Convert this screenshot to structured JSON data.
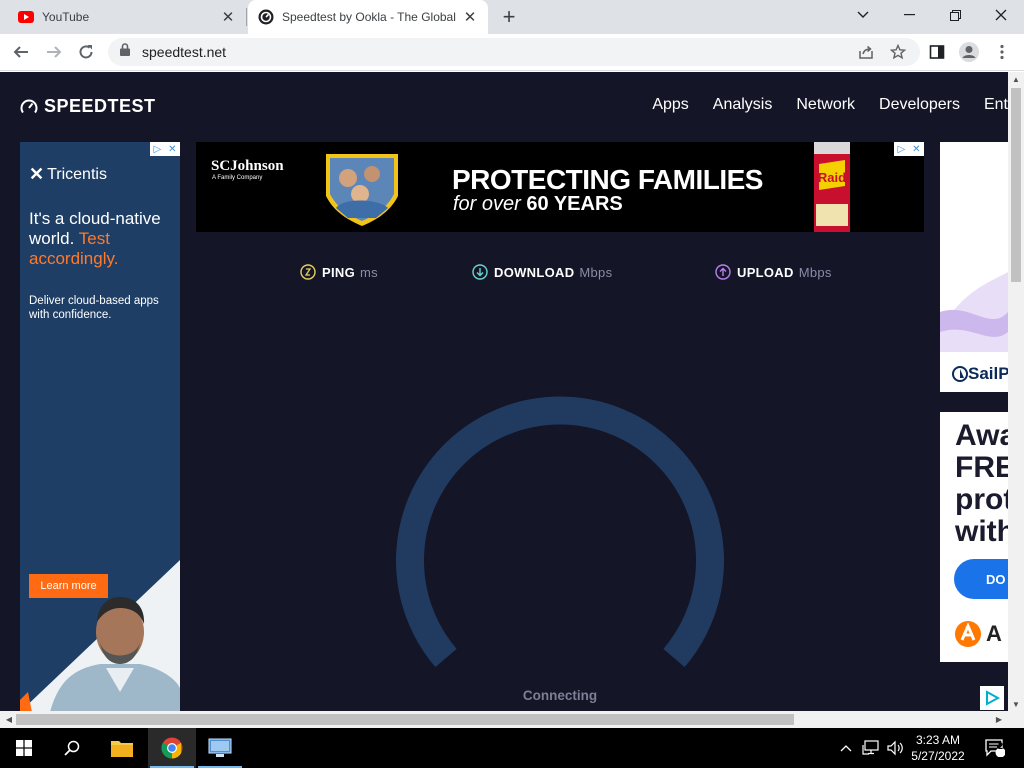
{
  "browser": {
    "tabs": [
      {
        "title": "YouTube",
        "icon": "youtube-icon",
        "active": false
      },
      {
        "title": "Speedtest by Ookla - The Global",
        "icon": "speedtest-icon",
        "active": true
      }
    ],
    "url": "speedtest.net"
  },
  "site": {
    "logo_text": "SPEEDTEST",
    "nav": [
      "Apps",
      "Analysis",
      "Network",
      "Developers",
      "Ent"
    ]
  },
  "ads": {
    "left": {
      "brand": "Tricentis",
      "headline_1": "It's a cloud-native world.",
      "headline_2": "Test accordingly.",
      "sub": "Deliver cloud-based apps with confidence.",
      "cta": "Learn more"
    },
    "banner": {
      "brand": "SCJohnson",
      "brand_sub": "A Family Company",
      "headline": "PROTECTING FAMILIES",
      "sub_italic": "for over",
      "sub_bold": "60 YEARS",
      "product": "Raid"
    },
    "right1": {
      "brand": "SailP"
    },
    "right2": {
      "big": "Awa FRE prot with",
      "cta": "DO",
      "brand": "A"
    }
  },
  "speedtest": {
    "ping_label": "PING",
    "ping_unit": "ms",
    "download_label": "DOWNLOAD",
    "download_unit": "Mbps",
    "upload_label": "UPLOAD",
    "upload_unit": "Mbps",
    "status": "Connecting",
    "colors": {
      "ping": "#e3d25b",
      "download": "#6ad6d0",
      "upload": "#b980f0",
      "gauge": "#213a5f"
    }
  },
  "taskbar": {
    "time": "3:23 AM",
    "date": "5/27/2022",
    "notification_count": "2"
  }
}
